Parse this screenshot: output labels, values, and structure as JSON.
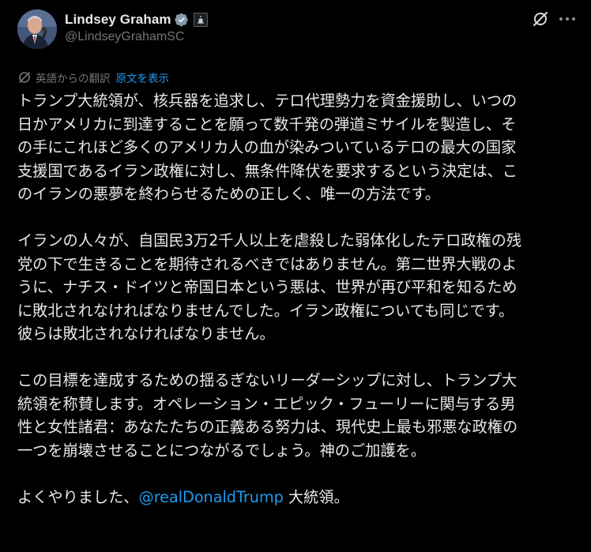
{
  "author": {
    "display_name": "Lindsey Graham",
    "handle": "@LindseyGrahamSC",
    "verified_icon": "verified-badge-icon",
    "affiliate_icon": "government-badge-icon"
  },
  "header_actions": {
    "grok_icon": "grok-icon",
    "more_icon": "more-options-icon"
  },
  "translation": {
    "label": "英語からの翻訳",
    "show_original": "原文を表示"
  },
  "post": {
    "paragraph_1": "トランプ大統領が、核兵器を追求し、テロ代理勢力を資金援助し、いつの\n日かアメリカに到達することを願って数千発の弾道ミサイルを製造し、そ\nの手にこれほど多くのアメリカ人の血が染みついているテロの最大の国家\n支援国であるイラン政権に対し、無条件降伏を要求するという決定は、こ\nのイランの悪夢を終わらせるための正しく、唯一の方法です。",
    "paragraph_2": "イランの人々が、自国民3万2千人以上を虐殺した弱体化したテロ政権の残\n党の下で生きることを期待されるべきではありません。第二世界大戦のよ\nうに、ナチス・ドイツと帝国日本という悪は、世界が再び平和を知るため\nに敗北されなければなりませんでした。イラン政権についても同じです。\n彼らは敗北されなければなりません。",
    "paragraph_3": "この目標を達成するための揺るぎないリーダーシップに対し、トランプ大\n統領を称賛します。オペレーション・エピック・フューリーに関与する男\n性と女性諸君：あなたたちの正義ある努力は、現代史上最も邪悪な政権の\n一つを崩壊させることにつながるでしょう。神のご加護を。",
    "paragraph_4_before": "よくやりました、",
    "mention": "@realDonaldTrump",
    "paragraph_4_after": " 大統領。"
  },
  "colors": {
    "background": "#000000",
    "text": "#e7e9ea",
    "muted": "#71767b",
    "link": "#1d9bf0",
    "verified": "#829aab"
  }
}
